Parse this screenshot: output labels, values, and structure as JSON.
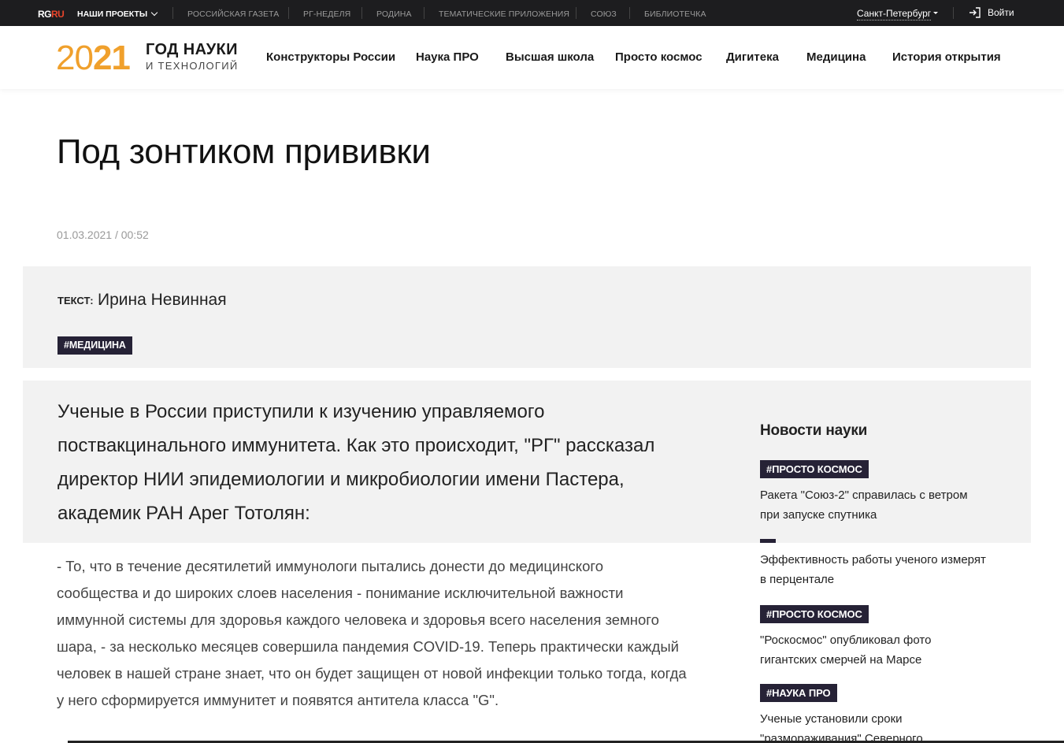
{
  "topbar": {
    "logo_rg": "RG",
    "logo_ru": "RU",
    "projects_label": "НАШИ ПРОЕКТЫ",
    "links": [
      "РОССИЙСКАЯ ГАЗЕТА",
      "РГ-НЕДЕЛЯ",
      "РОДИНА",
      "ТЕМАТИЧЕСКИЕ ПРИЛОЖЕНИЯ",
      "СОЮЗ",
      "БИБЛИОТЕЧКА"
    ],
    "city": "Санкт-Петербург",
    "login": "Войти"
  },
  "header": {
    "logo_year_prefix": "20",
    "logo_year_suffix": "21",
    "logo_title": "ГОД НАУКИ",
    "logo_subtitle": "И ТЕХНОЛОГИЙ",
    "nav": [
      "Конструкторы России",
      "Наука ПРО",
      "Высшая школа",
      "Просто космос",
      "Дигитека",
      "Медицина",
      "История открытия"
    ]
  },
  "article": {
    "title": "Под зонтиком прививки",
    "date": "01.03.2021 / 00:52",
    "author_label": "Текст:",
    "author_name": "Ирина Невинная",
    "tag": "#МЕДИЦИНА",
    "lead": "Ученые в России приступили к изучению управляемого поствакцинального иммунитета. Как это происходит, \"РГ\" рассказал директор НИИ эпидемиологии и микробиологии имени Пастера, академик РАН Арег Тотолян:",
    "body": "- То, что в течение десятилетий иммунологи пытались донести до медицинского сообщества и до широких слоев населения - понимание исключительной важности иммунной системы для здоровья каждого человека и здоровья всего населения земного шара, - за несколько месяцев совершила пандемия COVID-19. Теперь практически каждый человек в нашей стране знает, что он будет защищен от новой инфекции только тогда, когда у него сформируется иммунитет и появятся антитела класса \"G\"."
  },
  "sidebar": {
    "title": "Новости науки",
    "items": [
      {
        "tag": "#ПРОСТО КОСМОС",
        "text": "Ракета \"Союз-2\" справилась с ветром при запуске спутника"
      },
      {
        "tag": "",
        "text": "Эффективность работы ученого измерят в перцентале"
      },
      {
        "tag": "#ПРОСТО КОСМОС",
        "text": "\"Роскосмос\" опубликовал фото гигантских смерчей на Марсе"
      },
      {
        "tag": "#НАУКА ПРО",
        "text": "Ученые установили сроки \"размораживания\" Северного"
      }
    ]
  },
  "colors": {
    "accent": "#f0a02c",
    "tag_bg": "#262236",
    "topbar_bg": "#1d1d1f",
    "box_bg": "#f2f2f2"
  }
}
